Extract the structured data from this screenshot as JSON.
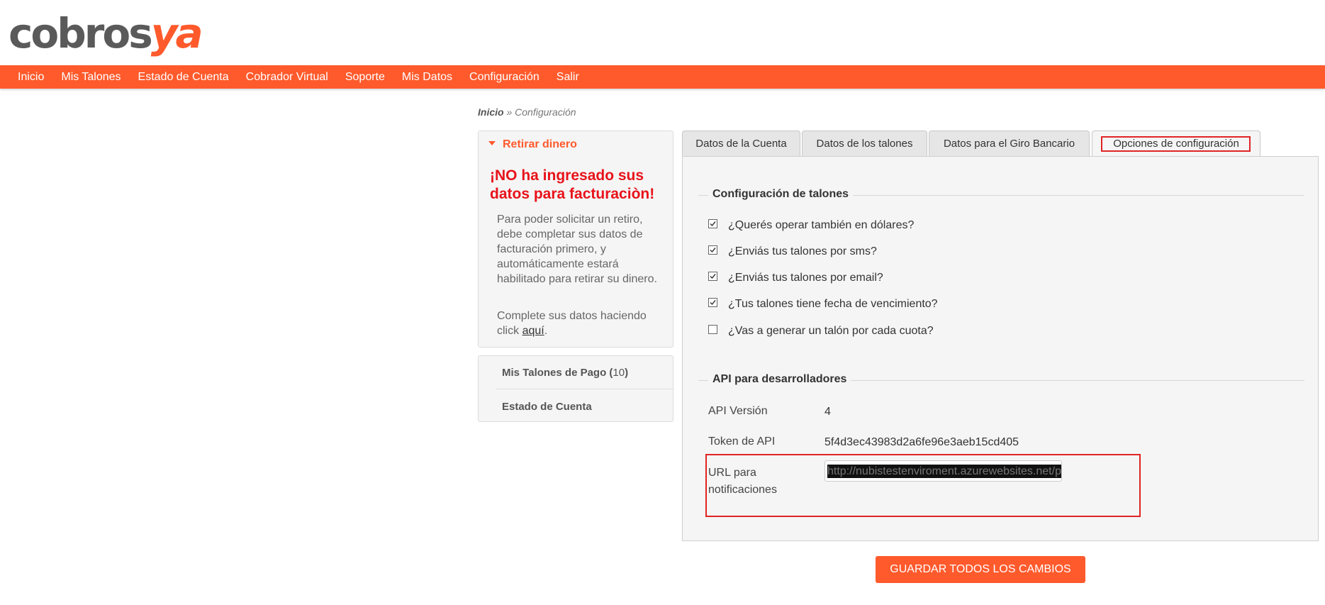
{
  "brand": {
    "logo_part1": "cobros",
    "logo_part2": "ya"
  },
  "nav": {
    "items": [
      "Inicio",
      "Mis Talones",
      "Estado de Cuenta",
      "Cobrador Virtual",
      "Soporte",
      "Mis Datos",
      "Configuración",
      "Salir"
    ]
  },
  "breadcrumb": {
    "home": "Inicio",
    "sep": " » ",
    "current": "Configuración"
  },
  "sidebar": {
    "withdraw": {
      "title": "Retirar dinero",
      "warning": "¡NO ha ingresado sus datos para facturaciòn!",
      "text": "Para poder solicitar un retiro, debe completar sus datos de facturación primero, y automáticamente estará habilitado para retirar su dinero.",
      "text2_prefix": "Complete sus datos haciendo click ",
      "text2_link": "aquí",
      "text2_suffix": "."
    },
    "menu": {
      "talones_label": "Mis Talones de Pago (",
      "talones_count": "10",
      "talones_close": ")",
      "estado_label": "Estado de Cuenta"
    }
  },
  "tabs": [
    "Datos de la Cuenta",
    "Datos de los talones",
    "Datos para el Giro Bancario",
    "Opciones de configuración"
  ],
  "talones": {
    "title": "Configuración de talones",
    "options": [
      {
        "label": "¿Querés operar también en dólares?",
        "checked": true
      },
      {
        "label": "¿Enviás tus talones por sms?",
        "checked": true
      },
      {
        "label": "¿Enviás tus talones por email?",
        "checked": true
      },
      {
        "label": "¿Tus talones tiene fecha de vencimiento?",
        "checked": true
      },
      {
        "label": "¿Vas a generar un talón por cada cuota?",
        "checked": false
      }
    ]
  },
  "api": {
    "title": "API para desarrolladores",
    "version_label": "API Versión",
    "version_value": "4",
    "token_label": "Token de API",
    "token_value": "5f4d3ec43983d2a6fe96e3aeb15cd405",
    "url_label": "URL para notificaciones",
    "url_value": "http://nubistestenviroment.azurewebsites.net/payr"
  },
  "save_button": "GUARDAR TODOS LOS CAMBIOS",
  "colors": {
    "accent": "#ff5a2c",
    "warning": "#e8121a",
    "highlight": "#e02424"
  }
}
